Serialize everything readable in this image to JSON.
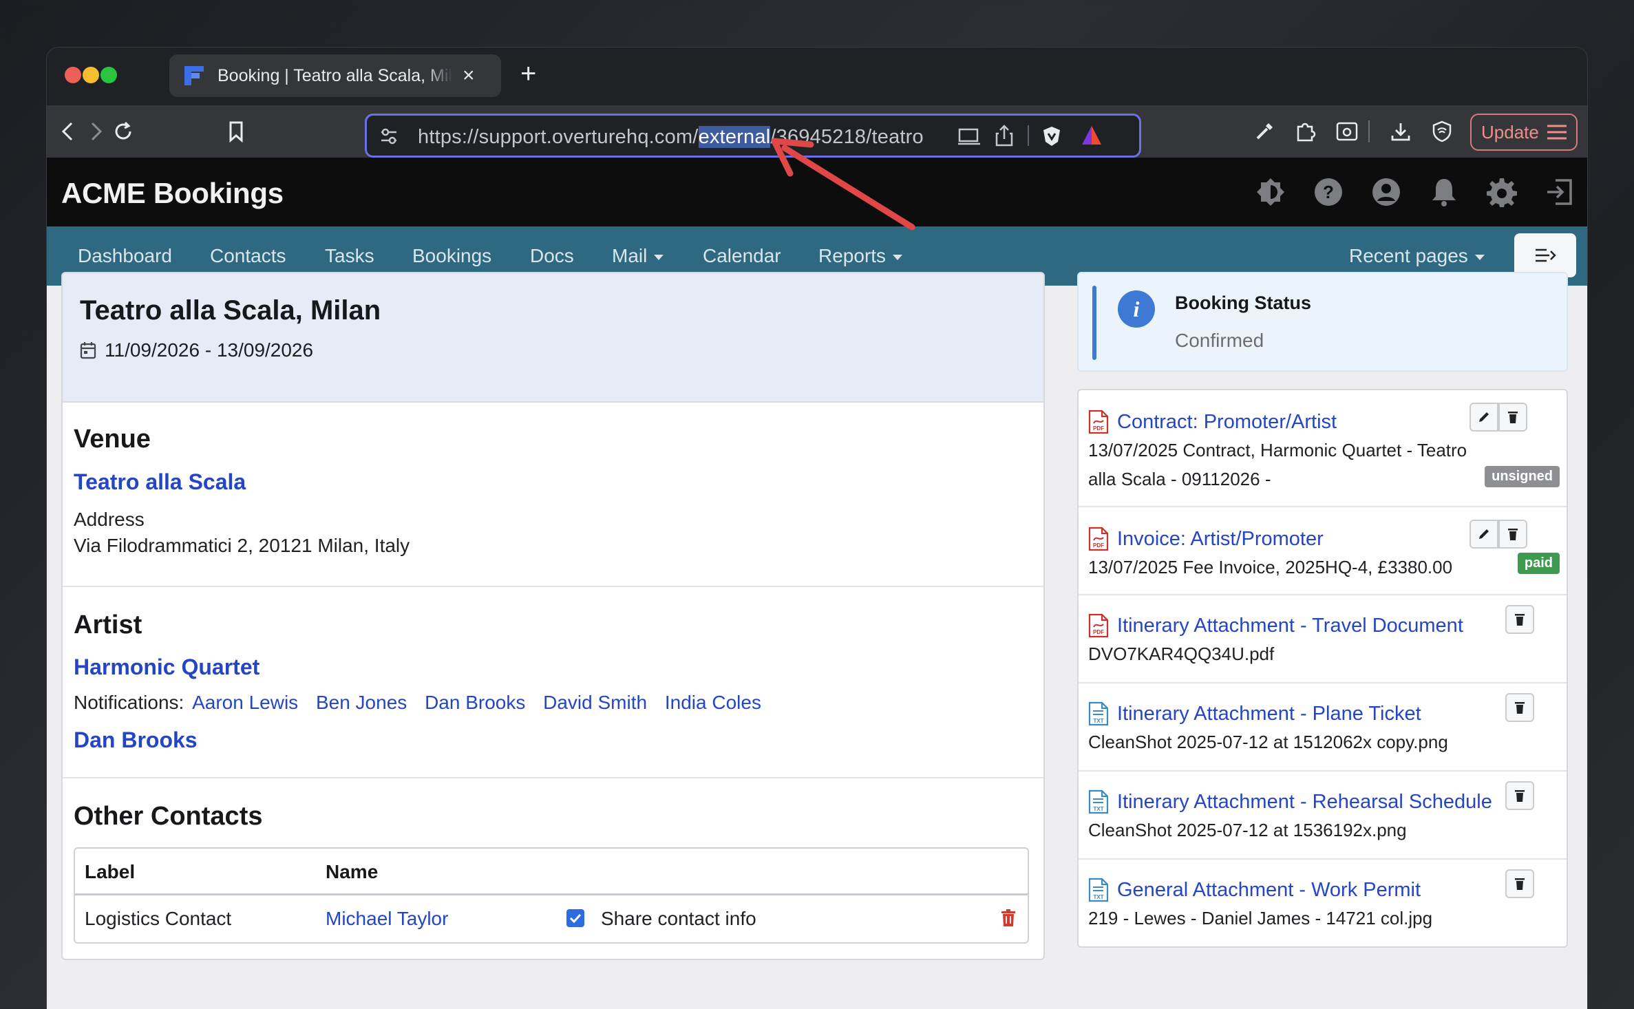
{
  "browser": {
    "tab_title": "Booking | Teatro alla Scala, Milan",
    "url_prefix": "https://support.overturehq.com/",
    "url_highlight": "external",
    "url_suffix": "/36945218/teatro",
    "update_label": "Update"
  },
  "app": {
    "brand": "ACME Bookings"
  },
  "nav": {
    "items": [
      "Dashboard",
      "Contacts",
      "Tasks",
      "Bookings",
      "Docs",
      "Mail",
      "Calendar",
      "Reports"
    ],
    "recent": "Recent pages"
  },
  "booking": {
    "title": "Teatro alla Scala, Milan",
    "dates": "11/09/2026 - 13/09/2026",
    "venue_heading": "Venue",
    "venue_name": "Teatro alla Scala",
    "address_label": "Address",
    "address": "Via Filodrammatici 2, 20121 Milan, Italy",
    "artist_heading": "Artist",
    "artist_name": "Harmonic Quartet",
    "notifications_label": "Notifications:",
    "notifications": [
      "Aaron Lewis",
      "Ben Jones",
      "Dan Brooks",
      "David Smith",
      "India Coles"
    ],
    "artist_contact": "Dan Brooks",
    "contacts_heading": "Other Contacts",
    "contacts_table": {
      "headers": [
        "Label",
        "Name"
      ],
      "row": {
        "label": "Logistics Contact",
        "name": "Michael Taylor",
        "share_label": "Share contact info",
        "share_checked": true
      }
    }
  },
  "status": {
    "heading": "Booking Status",
    "value": "Confirmed"
  },
  "attachments": [
    {
      "title": "Contract: Promoter/Artist",
      "desc1": "13/07/2025 Contract, Harmonic Quartet - Teatro",
      "desc2": "alla Scala - 09112026 -",
      "badge": "unsigned",
      "icon": "pdf-icon"
    },
    {
      "title": "Invoice: Artist/Promoter",
      "desc1": "13/07/2025 Fee Invoice, 2025HQ-4, £3380.00",
      "badge": "paid",
      "icon": "pdf-icon"
    },
    {
      "title": "Itinerary Attachment - Travel Document",
      "desc1": "DVO7KAR4QQ34U.pdf",
      "icon": "pdf-icon"
    },
    {
      "title": "Itinerary Attachment - Plane Ticket",
      "desc1": "CleanShot 2025-07-12 at 1512062x copy.png",
      "icon": "txt-icon"
    },
    {
      "title": "Itinerary Attachment - Rehearsal Schedule",
      "desc1": "CleanShot 2025-07-12 at 1536192x.png",
      "icon": "txt-icon"
    },
    {
      "title": "General Attachment - Work Permit",
      "desc1": "219 - Lewes - Daniel James - 14721 col.jpg",
      "icon": "txt-icon"
    }
  ],
  "colors": {
    "accent": "#2f6881",
    "link": "#2445c6",
    "badge_unsigned": "#8d8f93",
    "badge_paid": "#3e9a4e"
  }
}
